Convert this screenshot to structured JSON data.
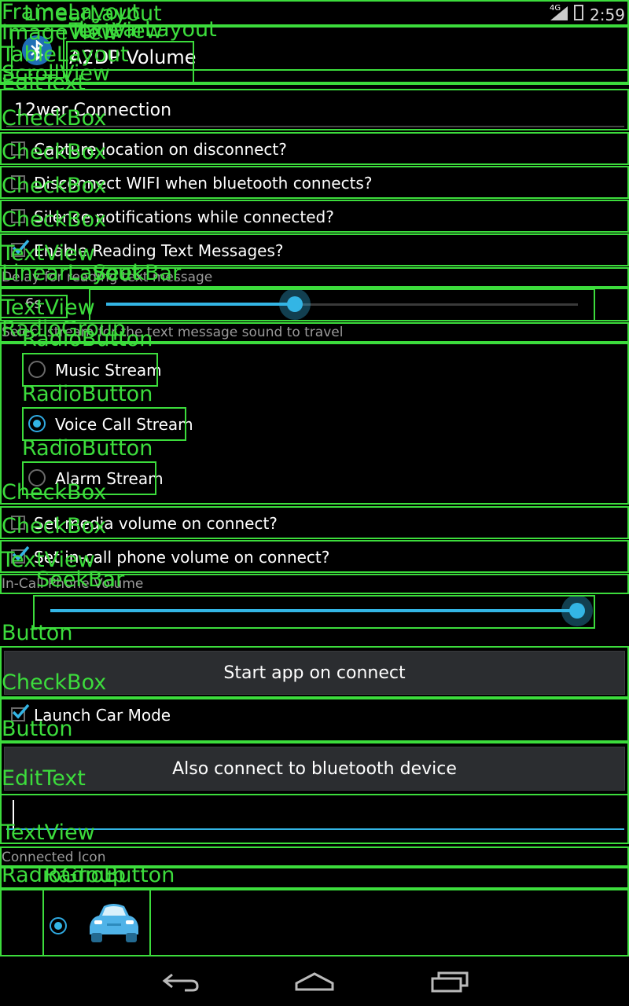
{
  "status_bar": {
    "network": "4G",
    "time": "2:59"
  },
  "header": {
    "title": "A2DP Volume"
  },
  "connection_name": "12wer Connection",
  "checkboxes": {
    "capture_location": {
      "label": "Capture location on disconnect?",
      "checked": false
    },
    "disconnect_wifi": {
      "label": "Disconnect WIFI when bluetooth connects?",
      "checked": false
    },
    "silence_notifications": {
      "label": "Silence notifications while connected?",
      "checked": false
    },
    "reading_texts": {
      "label": "Enable Reading Text Messages?",
      "checked": true
    },
    "set_media_volume": {
      "label": "Set media volume on connect?",
      "checked": false
    },
    "set_incall_volume": {
      "label": "Set in-call phone volume on connect?",
      "checked": true
    },
    "launch_car_mode": {
      "label": "Launch Car Mode",
      "checked": true
    }
  },
  "delay": {
    "label": "Delay for reading text message",
    "value_text": "6s",
    "fraction": 0.4
  },
  "stream": {
    "label": "Select stream for the text message sound to travel",
    "options": [
      "Music Stream",
      "Voice Call Stream",
      "Alarm Stream"
    ],
    "selected": "Voice Call Stream"
  },
  "incall_volume": {
    "label": "In-Call Phone Volume",
    "fraction": 1.0
  },
  "buttons": {
    "start_app": "Start app on connect",
    "also_connect": "Also connect to bluetooth device"
  },
  "connected_icon": {
    "label": "Connected Icon",
    "icon": "car-icon"
  },
  "overlay_labels": {
    "textview": "TextView",
    "checkbox": "CheckBox",
    "linearlayout": "LinearLayout",
    "seekbar": "SeekBar",
    "radiogroup": "RadioGroup",
    "radiobutton": "RadioButton",
    "button": "Button",
    "edittext": "EditText",
    "imageview": "ImageView",
    "framelayout": "FrameLayout",
    "tablelayout": "TableLayout",
    "scrollview": "ScrollView"
  },
  "colors": {
    "accent": "#33b5e5",
    "overlay": "#3cdc3c",
    "background": "#000000"
  }
}
